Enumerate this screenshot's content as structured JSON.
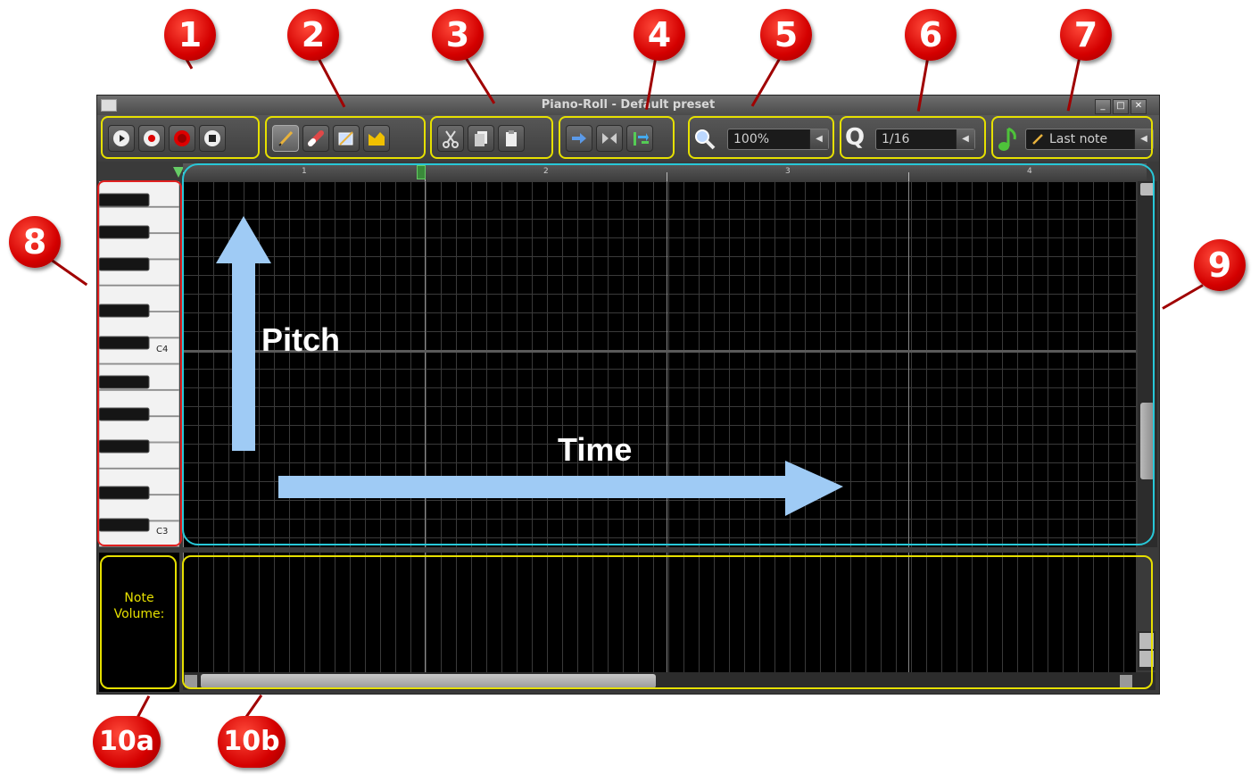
{
  "window": {
    "title": "Piano-Roll - Default preset",
    "minimize_label": "_",
    "maximize_label": "□",
    "close_label": "✕"
  },
  "toolbar": {
    "zoom_value": "100%",
    "quantize_letter": "Q",
    "quantize_value": "1/16",
    "note_length_value": "Last note"
  },
  "ruler": {
    "bars": [
      "1",
      "2",
      "3",
      "4"
    ]
  },
  "piano": {
    "c4_label": "C4",
    "c3_label": "C3"
  },
  "annotations": {
    "pitch": "Pitch",
    "time": "Time"
  },
  "volume_panel": {
    "label": "Note Volume:"
  },
  "callouts": [
    "1",
    "2",
    "3",
    "4",
    "5",
    "6",
    "7",
    "8",
    "9",
    "10a",
    "10b"
  ],
  "colors": {
    "callout_red": "#d40000",
    "highlight_yellow": "#e6e000",
    "highlight_cyan": "#28c8d8",
    "highlight_red": "#e02020",
    "arrow_blue": "#9fcbf5"
  }
}
